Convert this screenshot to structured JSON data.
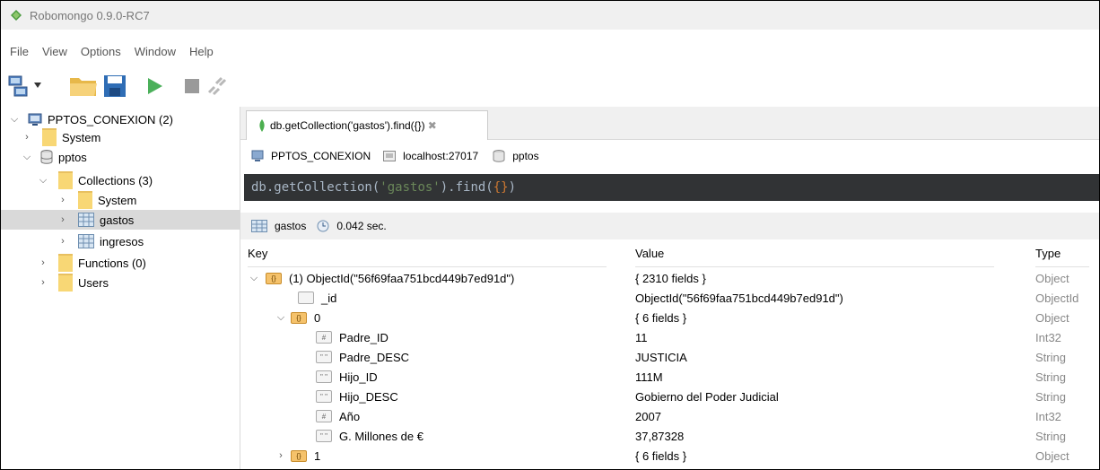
{
  "window": {
    "title": "Robomongo 0.9.0-RC7"
  },
  "menu": [
    "File",
    "View",
    "Options",
    "Window",
    "Help"
  ],
  "sidebar": {
    "connection": "PPTOS_CONEXION (2)",
    "items": [
      {
        "label": "System"
      },
      {
        "label": "pptos"
      },
      {
        "label": "Collections (3)"
      },
      {
        "label": "System"
      },
      {
        "label": "gastos"
      },
      {
        "label": "ingresos"
      },
      {
        "label": "Functions (0)"
      },
      {
        "label": "Users"
      }
    ]
  },
  "tab": {
    "label": "db.getCollection('gastos').find({})"
  },
  "info": {
    "connection": "PPTOS_CONEXION",
    "host": "localhost:27017",
    "database": "pptos"
  },
  "query": {
    "prefix": "db.getCollection(",
    "arg": "'gastos'",
    "mid": ").find(",
    "braces": "{}",
    "suffix": ")"
  },
  "result": {
    "collection": "gastos",
    "time": "0.042 sec."
  },
  "columns": {
    "key": "Key",
    "value": "Value",
    "type": "Type"
  },
  "rows": [
    {
      "key": "(1) ObjectId(\"56f69faa751bcd449b7ed91d\")",
      "value": "{ 2310 fields }",
      "type": "Object"
    },
    {
      "key": "_id",
      "value": "ObjectId(\"56f69faa751bcd449b7ed91d\")",
      "type": "ObjectId"
    },
    {
      "key": "0",
      "value": "{ 6 fields }",
      "type": "Object"
    },
    {
      "key": "Padre_ID",
      "value": "11",
      "type": "Int32"
    },
    {
      "key": "Padre_DESC",
      "value": "JUSTICIA",
      "type": "String"
    },
    {
      "key": "Hijo_ID",
      "value": "111M",
      "type": "String"
    },
    {
      "key": "Hijo_DESC",
      "value": "Gobierno del Poder Judicial",
      "type": "String"
    },
    {
      "key": "Año",
      "value": "2007",
      "type": "Int32"
    },
    {
      "key": "G. Millones de €",
      "value": "37,87328",
      "type": "String"
    },
    {
      "key": "1",
      "value": "{ 6 fields }",
      "type": "Object"
    }
  ],
  "colors": {
    "query_bg": "#313335",
    "query_text": "#a9b7c6",
    "query_string": "#6a8759",
    "query_brace": "#cc7832",
    "selection": "#d9d9d9"
  }
}
